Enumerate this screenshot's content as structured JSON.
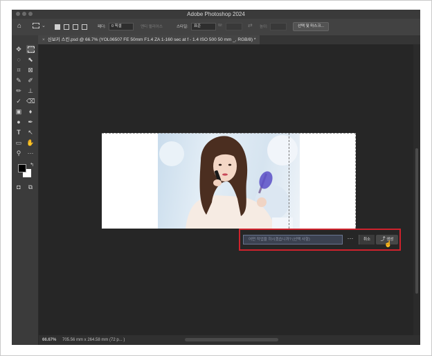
{
  "window": {
    "title": "Adobe Photoshop 2024"
  },
  "options_bar": {
    "feather_label": "페더:",
    "feather_value": "0 픽셀",
    "antialias_label": "앤티 앨리어스",
    "style_label": "스타일:",
    "style_value": "표준",
    "width_label": "W:",
    "height_label": "높이:",
    "select_mask_button": "선택 및 마스크..."
  },
  "document_tab": {
    "label": "신보키 스킨.psd @ 66.7% (YOL06507  FE 50mm F1.4 ZA  1-160 sec at f - 1.4  ISO 500 50 mm _, RGB/8) *"
  },
  "contextual_task_bar": {
    "prompt_placeholder": "어떤 작업을 하시겠습니까? (선택 사항)",
    "more_label": "···",
    "cancel_label": "취소",
    "generate_label": "생성",
    "highlight_color": "#d0222c"
  },
  "status_bar": {
    "zoom": "66.67%",
    "doc_size": "705.56 mm x 264.58 mm (72 p... )"
  },
  "tools": [
    "move-tool-icon",
    "marquee-tool-icon",
    "lasso-tool-icon",
    "object-select-icon",
    "crop-tool-icon",
    "frame-tool-icon",
    "eyedropper-icon",
    "healing-brush-icon",
    "brush-tool-icon",
    "clone-stamp-icon",
    "history-brush-icon",
    "eraser-icon",
    "gradient-tool-icon",
    "blur-tool-icon",
    "dodge-tool-icon",
    "pen-tool-icon",
    "type-tool-icon",
    "path-select-icon",
    "rectangle-tool-icon",
    "hand-tool-icon",
    "zoom-tool-icon",
    "more-tools-icon"
  ]
}
